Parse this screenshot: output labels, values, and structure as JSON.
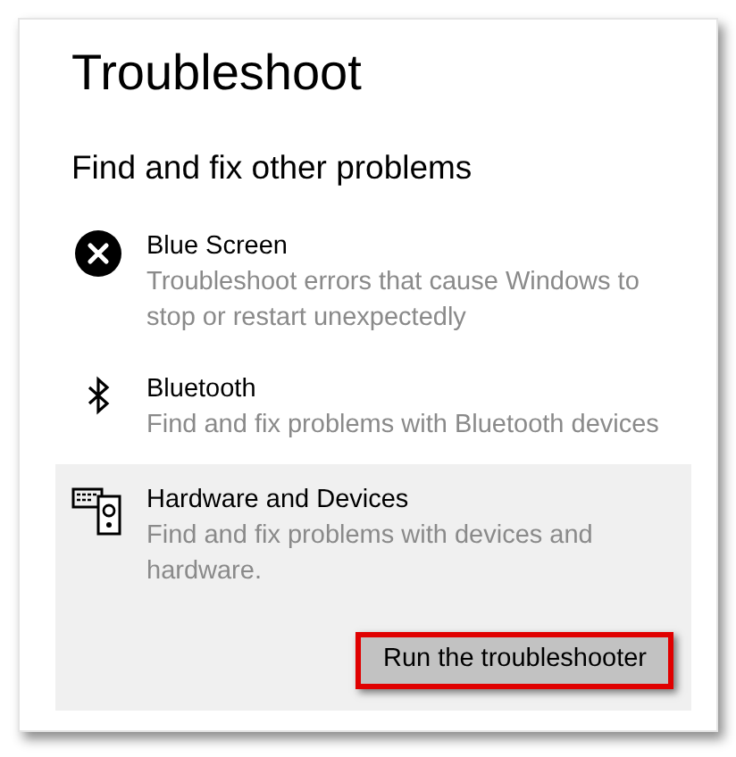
{
  "title": "Troubleshoot",
  "section_heading": "Find and fix other problems",
  "items": [
    {
      "kind": "error",
      "name": "Blue Screen",
      "description": "Troubleshoot errors that cause Windows to stop or restart unexpectedly",
      "selected": false
    },
    {
      "kind": "bluetooth",
      "name": "Bluetooth",
      "description": "Find and fix problems with Bluetooth devices",
      "selected": false
    },
    {
      "kind": "hardware",
      "name": "Hardware and Devices",
      "description": "Find and fix problems with devices and hardware.",
      "selected": true
    }
  ],
  "run_button": {
    "label": "Run the troubleshooter",
    "highlighted": true
  }
}
